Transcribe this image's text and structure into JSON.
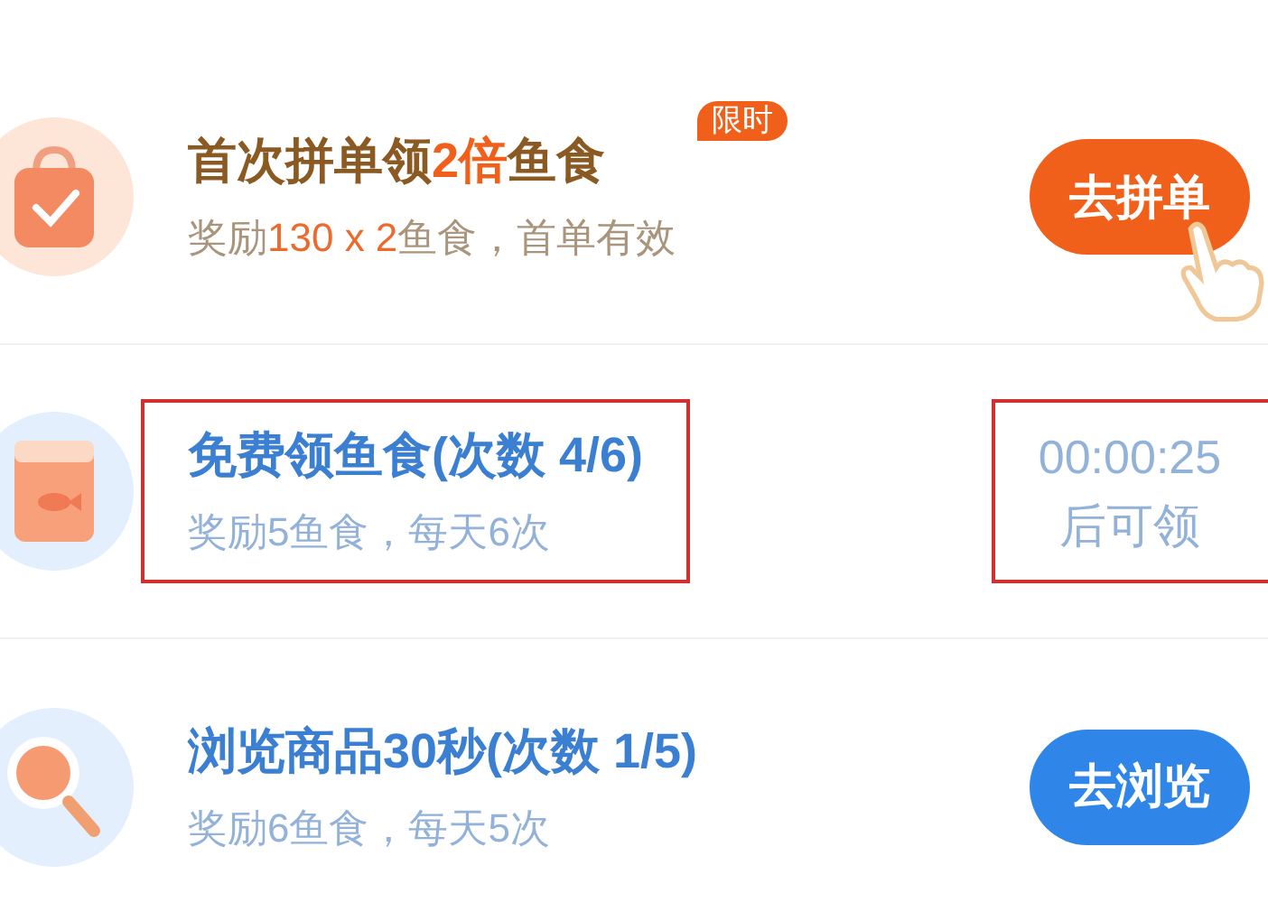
{
  "tasks": [
    {
      "title": [
        {
          "text": "首次拼单领",
          "accent": false
        },
        {
          "text": "2倍",
          "accent": true
        },
        {
          "text": "鱼食",
          "accent": false
        }
      ],
      "badge": "限时",
      "subtitle": [
        {
          "text": "奖励",
          "accent": false
        },
        {
          "text": "130 x 2",
          "accent": true
        },
        {
          "text": "鱼食，首单有效",
          "accent": false
        }
      ],
      "highlighted": false,
      "action": {
        "kind": "button",
        "label": "去拼单",
        "pointer": true
      }
    },
    {
      "title": [
        {
          "text": "免费领鱼食(次数 4/6)",
          "accent": false
        }
      ],
      "subtitle": [
        {
          "text": "奖励5鱼食，每天6次",
          "accent": false
        }
      ],
      "highlighted": true,
      "action": {
        "kind": "countdown",
        "time": "00:00:25",
        "label": "后可领",
        "highlighted": true
      }
    },
    {
      "title": [
        {
          "text": "浏览商品30秒(次数 1/5)",
          "accent": false
        }
      ],
      "subtitle": [
        {
          "text": "奖励6鱼食，每天5次",
          "accent": false
        }
      ],
      "highlighted": false,
      "action": {
        "kind": "button",
        "label": "去浏览",
        "pointer": false
      }
    }
  ]
}
